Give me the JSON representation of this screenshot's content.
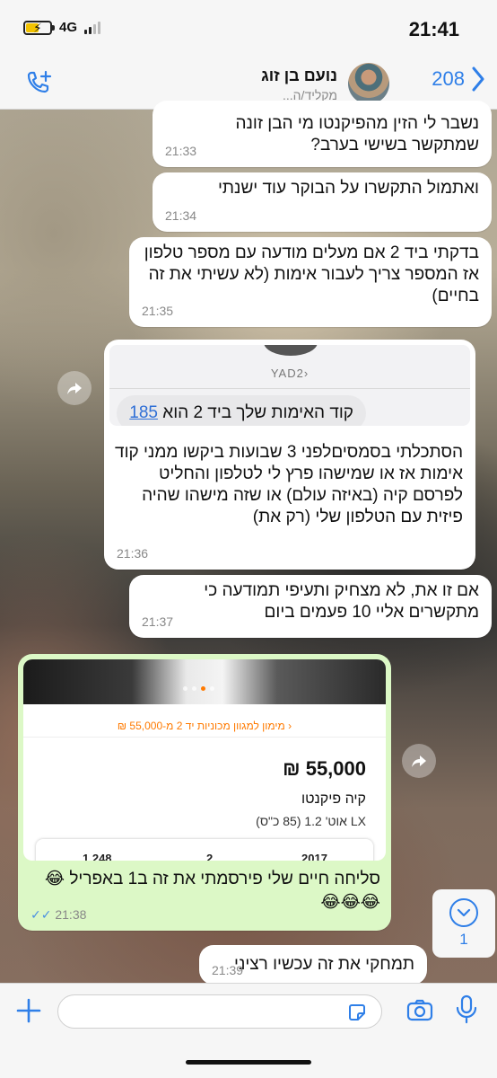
{
  "status_bar": {
    "time": "21:41",
    "network": "4G",
    "battery_level": 0.55,
    "signal_bars": 2
  },
  "header": {
    "back_count": "208",
    "contact_name": "נועם בן זוג",
    "contact_subtitle": "מקליד/ה..."
  },
  "messages": [
    {
      "text": "נשבר לי הזין מהפיקנטו מי הבן זונה שמתקשר בשישי בערב?",
      "time": "21:33"
    },
    {
      "text": "ואתמול התקשרו על הבוקר עוד ישנתי",
      "time": "21:34"
    },
    {
      "text": "בדקתי ביד 2 אם מעלים מודעה עם מספר טלפון אז המספר צריך לעבור אימות (לא עשיתי את זה בחיים)",
      "time": "21:35"
    },
    {
      "text": "הסתכלתי בסמסים‏לפני 3 שבועות ביקשו ממני קוד אימות אז או שמישהו פרץ לי לטלפון והחליט לפרסם קיה (באיזה עולם) או שזה מישהו שהיה פיזית עם הטלפון שלי (רק את)",
      "time": "21:36"
    },
    {
      "text": "אם זו את, לא מצחיק ותעיפי תמודעה כי מתקשרים אליי 10 פעמים ביום",
      "time": "21:37"
    },
    {
      "text": "סליחה חיים שלי פירסמתי את זה ב1 באפריל 😂😂😂😂",
      "time": "21:38",
      "status": "✓✓"
    },
    {
      "text": "תמחקי את זה עכשיו רציני",
      "time": "21:39"
    }
  ],
  "sms_screenshot": {
    "sender": "YAD2",
    "sms_text": "קוד האימות שלך ביד 2 הוא",
    "code": "185"
  },
  "car_ad": {
    "funding_text": "מימון למגוון מכוניות יד 2 מ-55,000 ₪",
    "price": "55,000 ₪",
    "model": "קיה פיקנטו",
    "trim": "LX אוט' 1.2 (85 כ\"ס)",
    "specs": [
      "1,248",
      "2",
      "2017"
    ]
  },
  "scroll_badge": {
    "count": "1"
  },
  "icons": {
    "back": "chevron-left-icon",
    "call": "phone-add-icon",
    "forward": "forward-icon",
    "plus": "plus-icon",
    "sticker": "sticker-icon",
    "camera": "camera-icon",
    "mic": "microphone-icon",
    "scroll": "chevron-down-icon"
  },
  "colors": {
    "accent": "#2f7fe8",
    "outgoing_bubble": "#dcf8c6",
    "incoming_bubble": "#ffffff",
    "yad2_orange": "#ff7a00"
  }
}
